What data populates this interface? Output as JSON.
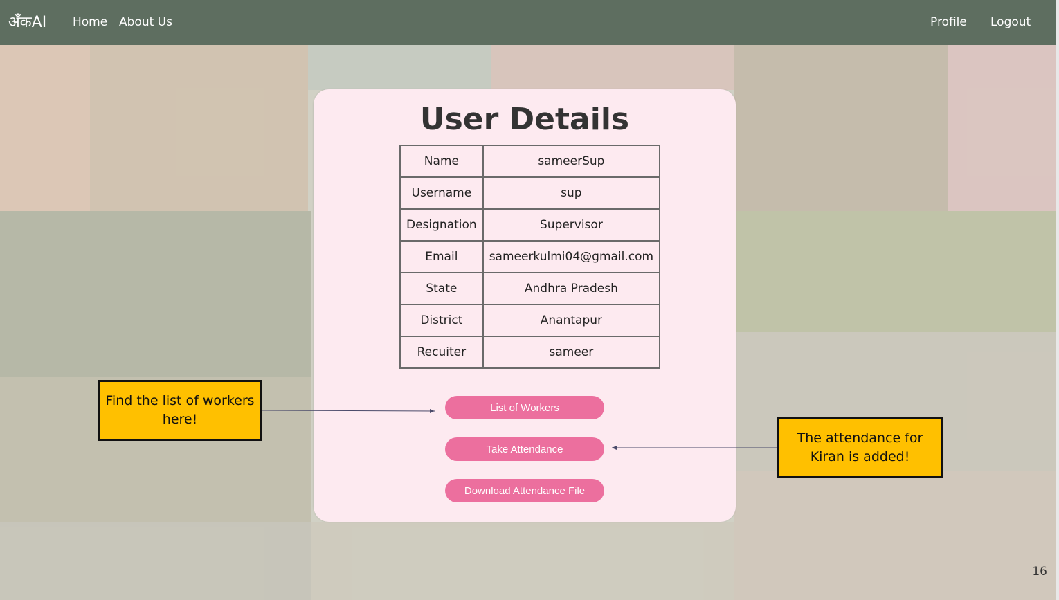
{
  "navbar": {
    "brand": "अँकAI",
    "links": [
      "Home",
      "About Us"
    ],
    "right_links": [
      "Profile",
      "Logout"
    ],
    "bg_color": "#5e6e60"
  },
  "card": {
    "title": "User Details",
    "rows": [
      {
        "label": "Name",
        "value": "sameerSup"
      },
      {
        "label": "Username",
        "value": "sup"
      },
      {
        "label": "Designation",
        "value": "Supervisor"
      },
      {
        "label": "Email",
        "value": "sameerkulmi04@gmail.com"
      },
      {
        "label": "State",
        "value": "Andhra Pradesh"
      },
      {
        "label": "District",
        "value": "Anantapur"
      },
      {
        "label": "Recuiter",
        "value": "sameer"
      }
    ],
    "buttons": [
      "List of Workers",
      "Take Attendance",
      "Download Attendance File"
    ],
    "button_color": "#ec6f9e",
    "bg_color": "#fdeaf0"
  },
  "callouts": {
    "left": "Find the list of workers here!",
    "right": "The attendance for Kiran is added!",
    "color": "#ffc000"
  },
  "slide_number": "16"
}
